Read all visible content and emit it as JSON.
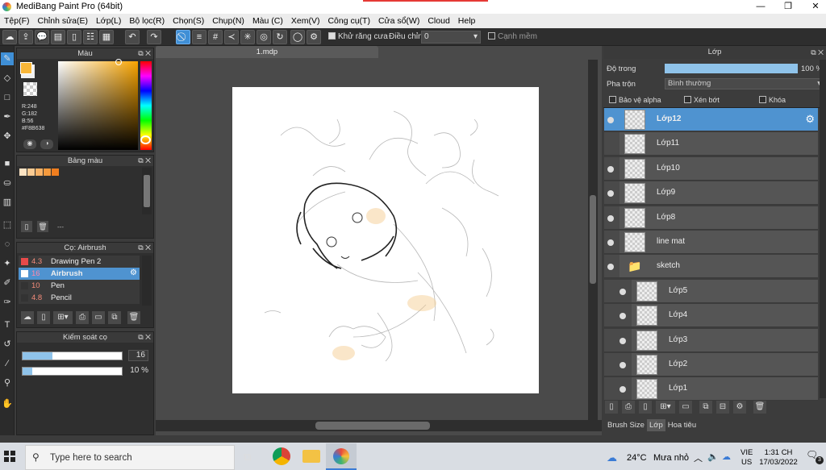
{
  "window": {
    "title": "MediBang Paint Pro (64bit)",
    "minimize": "—",
    "maximize": "❐",
    "close": "✕"
  },
  "menu": [
    "Tệp(F)",
    "Chỉnh sửa(E)",
    "Lớp(L)",
    "Bộ lọc(R)",
    "Chọn(S)",
    "Chụp(N)",
    "Màu (C)",
    "Xem(V)",
    "Công cụ(T)",
    "Cửa sổ(W)",
    "Cloud",
    "Help"
  ],
  "toolbar": {
    "antialias_label": "Khử răng cưa",
    "adjust_label": "Điều chỉnh",
    "adjust_value": "0",
    "edge_label": "Cạnh mềm"
  },
  "color_panel": {
    "title": "Màu",
    "r": "R:248",
    "g": "G:182",
    "b": "B:56",
    "hex": "#F8B638",
    "primary_color": "#F8B638",
    "hue_marker_color": "#F8B638"
  },
  "palette_panel": {
    "title": "Bảng màu",
    "swatches": [
      "#FDE3C3",
      "#FBCB93",
      "#F9B266",
      "#F59A3D",
      "#F07E1F"
    ],
    "footer_text": "---"
  },
  "brush_panel": {
    "title": "Cọ: Airbrush",
    "items": [
      {
        "size": "4.3",
        "name": "Drawing Pen 2",
        "swatch": "#e84a4a"
      },
      {
        "size": "16",
        "name": "Airbrush",
        "swatch": "#ffffff"
      },
      {
        "size": "10",
        "name": "Pen",
        "swatch": "#333333"
      },
      {
        "size": "4.8",
        "name": "Pencil",
        "swatch": "#333333"
      }
    ]
  },
  "brush_control": {
    "title": "Kiểm soát cọ",
    "size_value": "16",
    "size_fraction": 0.3,
    "opacity_value": "10 %",
    "opacity_fraction": 0.1
  },
  "document": {
    "tab": "1.mdp"
  },
  "layer_panel": {
    "title": "Lớp",
    "opacity_label": "Độ trong",
    "opacity_value": "100 %",
    "opacity_fraction": 1.0,
    "blend_label": "Pha trộn",
    "blend_value": "Bình thường",
    "protect_alpha": "Bảo vệ alpha",
    "clipping": "Xén bớt",
    "lock": "Khóa",
    "layers": [
      {
        "name": "Lớp12",
        "selected": true,
        "visible": true
      },
      {
        "name": "Lớp11",
        "selected": false,
        "visible": false
      },
      {
        "name": "Lớp10",
        "selected": false,
        "visible": true
      },
      {
        "name": "Lớp9",
        "selected": false,
        "visible": true
      },
      {
        "name": "Lớp8",
        "selected": false,
        "visible": true
      },
      {
        "name": "line mat",
        "selected": false,
        "visible": true
      },
      {
        "name": "sketch",
        "selected": false,
        "visible": true,
        "folder": true
      },
      {
        "name": "Lớp5",
        "selected": false,
        "visible": true,
        "child": true
      },
      {
        "name": "Lớp4",
        "selected": false,
        "visible": true,
        "child": true
      },
      {
        "name": "Lớp3",
        "selected": false,
        "visible": true,
        "child": true
      },
      {
        "name": "Lớp2",
        "selected": false,
        "visible": true,
        "child": true
      },
      {
        "name": "Lớp1",
        "selected": false,
        "visible": true,
        "child": true
      }
    ],
    "bottom_tabs": [
      "Brush Size",
      "Lớp",
      "Hoa tiêu"
    ]
  },
  "taskbar": {
    "search_placeholder": "Type here to search",
    "weather_temp": "24°C",
    "weather_text": "Mưa nhỏ",
    "lang_top": "VIE",
    "lang_bottom": "US",
    "time": "1:31 CH",
    "date": "17/03/2022",
    "notification_count": "3"
  }
}
